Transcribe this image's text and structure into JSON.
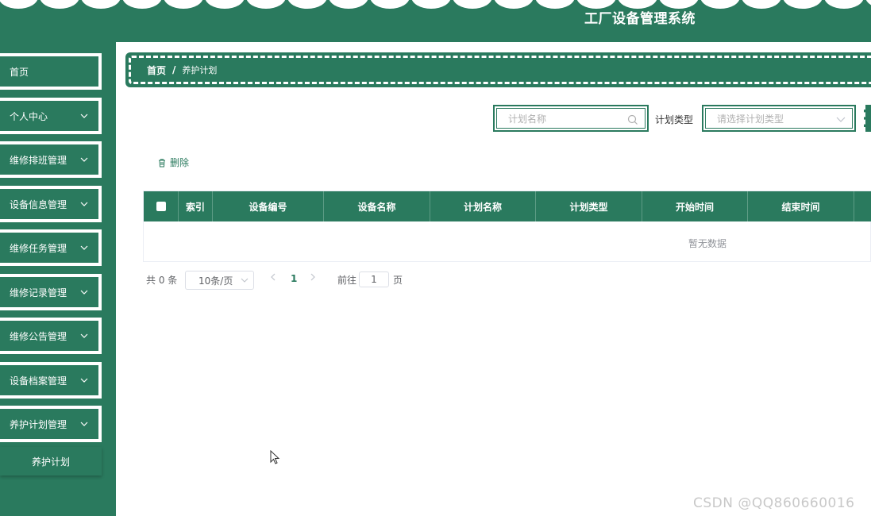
{
  "header": {
    "title": "工厂设备管理系统"
  },
  "sidebar": {
    "items": [
      {
        "label": "首页",
        "has_chevron": false
      },
      {
        "label": "个人中心",
        "has_chevron": true
      },
      {
        "label": "维修排班管理",
        "has_chevron": true
      },
      {
        "label": "设备信息管理",
        "has_chevron": true
      },
      {
        "label": "维修任务管理",
        "has_chevron": true
      },
      {
        "label": "维修记录管理",
        "has_chevron": true
      },
      {
        "label": "维修公告管理",
        "has_chevron": true
      },
      {
        "label": "设备档案管理",
        "has_chevron": true
      },
      {
        "label": "养护计划管理",
        "has_chevron": true
      }
    ],
    "sub_item": {
      "label": "养护计划"
    }
  },
  "breadcrumb": {
    "home": "首页",
    "separator": "/",
    "current": "养护计划"
  },
  "search": {
    "name_placeholder": "计划名称",
    "type_label": "计划类型",
    "type_placeholder": "请选择计划类型"
  },
  "toolbar": {
    "delete_label": "删除"
  },
  "table": {
    "columns": [
      "索引",
      "设备编号",
      "设备名称",
      "计划名称",
      "计划类型",
      "开始时间",
      "结束时间"
    ],
    "empty_text": "暂无数据"
  },
  "pagination": {
    "total_text": "共 0 条",
    "page_size": "10条/页",
    "current_page": "1",
    "goto_prefix": "前往",
    "goto_value": "1",
    "goto_suffix": "页"
  },
  "watermark": "CSDN @QQ860660016",
  "colors": {
    "primary": "#2a7a5e",
    "white": "#ffffff",
    "muted": "#909399"
  }
}
